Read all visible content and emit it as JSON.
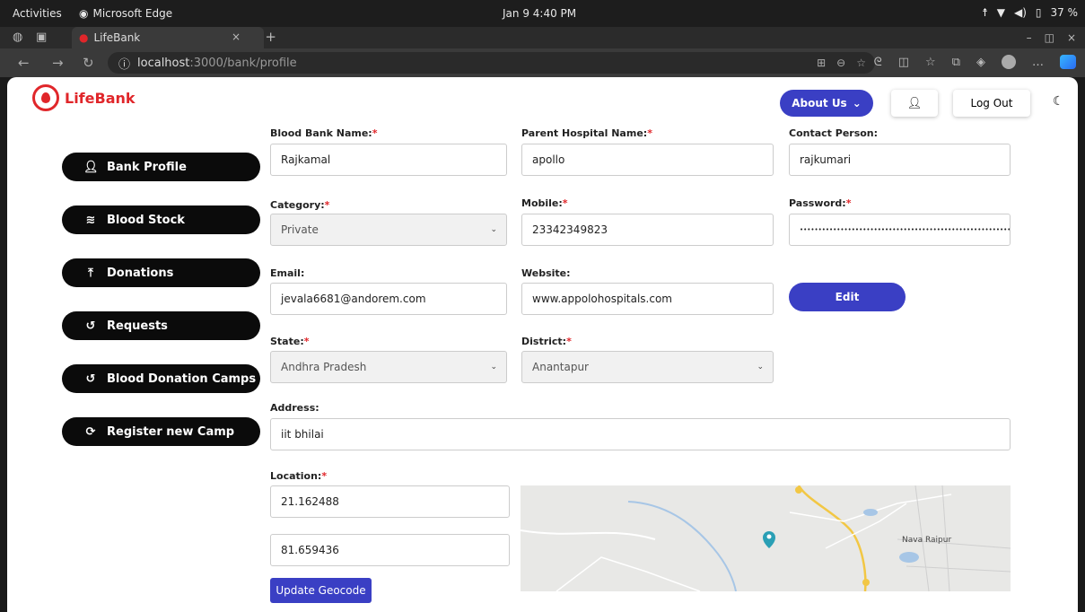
{
  "os": {
    "activities": "Activities",
    "app_name": "Microsoft Edge",
    "clock": "Jan 9  4:40 PM",
    "battery": "37 %"
  },
  "browser": {
    "tab_title": "LifeBank",
    "url_host": "localhost",
    "url_path": ":3000/bank/profile"
  },
  "header": {
    "brand": "LifeBank",
    "about_label": "About Us",
    "logout_label": "Log Out"
  },
  "sidebar": {
    "items": [
      {
        "label": "Bank Profile",
        "icon": "user-icon"
      },
      {
        "label": "Blood Stock",
        "icon": "layers-icon"
      },
      {
        "label": "Donations",
        "icon": "hand-holding-icon"
      },
      {
        "label": "Requests",
        "icon": "history-icon"
      },
      {
        "label": "Blood Donation Camps",
        "icon": "history-icon"
      },
      {
        "label": "Register new Camp",
        "icon": "refresh-icon"
      }
    ]
  },
  "form": {
    "bank_name": {
      "label": "Blood Bank Name:",
      "value": "Rajkamal"
    },
    "parent_hospital": {
      "label": "Parent Hospital Name:",
      "value": "apollo"
    },
    "contact_person": {
      "label": "Contact Person:",
      "value": "rajkumari"
    },
    "category": {
      "label": "Category:",
      "value": "Private"
    },
    "mobile": {
      "label": "Mobile:",
      "value": "23342349823"
    },
    "password": {
      "label": "Password:",
      "value": "••••••••••••••••••••••••••••••••••••••••••••••••••••••••••"
    },
    "email": {
      "label": "Email:",
      "value": "jevala6681@andorem.com"
    },
    "website": {
      "label": "Website:",
      "value": "www.appolohospitals.com"
    },
    "edit_label": "Edit",
    "state": {
      "label": "State:",
      "value": "Andhra Pradesh"
    },
    "district": {
      "label": "District:",
      "value": "Anantapur"
    },
    "address": {
      "label": "Address:",
      "value": "iit bhilai"
    },
    "location": {
      "label": "Location:",
      "lat": "21.162488",
      "lng": "81.659436"
    },
    "geocode_label": "Update Geocode",
    "required_mark": "*"
  },
  "map": {
    "place_label": "Nava Raipur",
    "pin_color": "#2a9fb5"
  },
  "colors": {
    "accent": "#3a3fc4",
    "brand_red": "#e0262a",
    "sidebar_bg": "#0b0b0b"
  }
}
